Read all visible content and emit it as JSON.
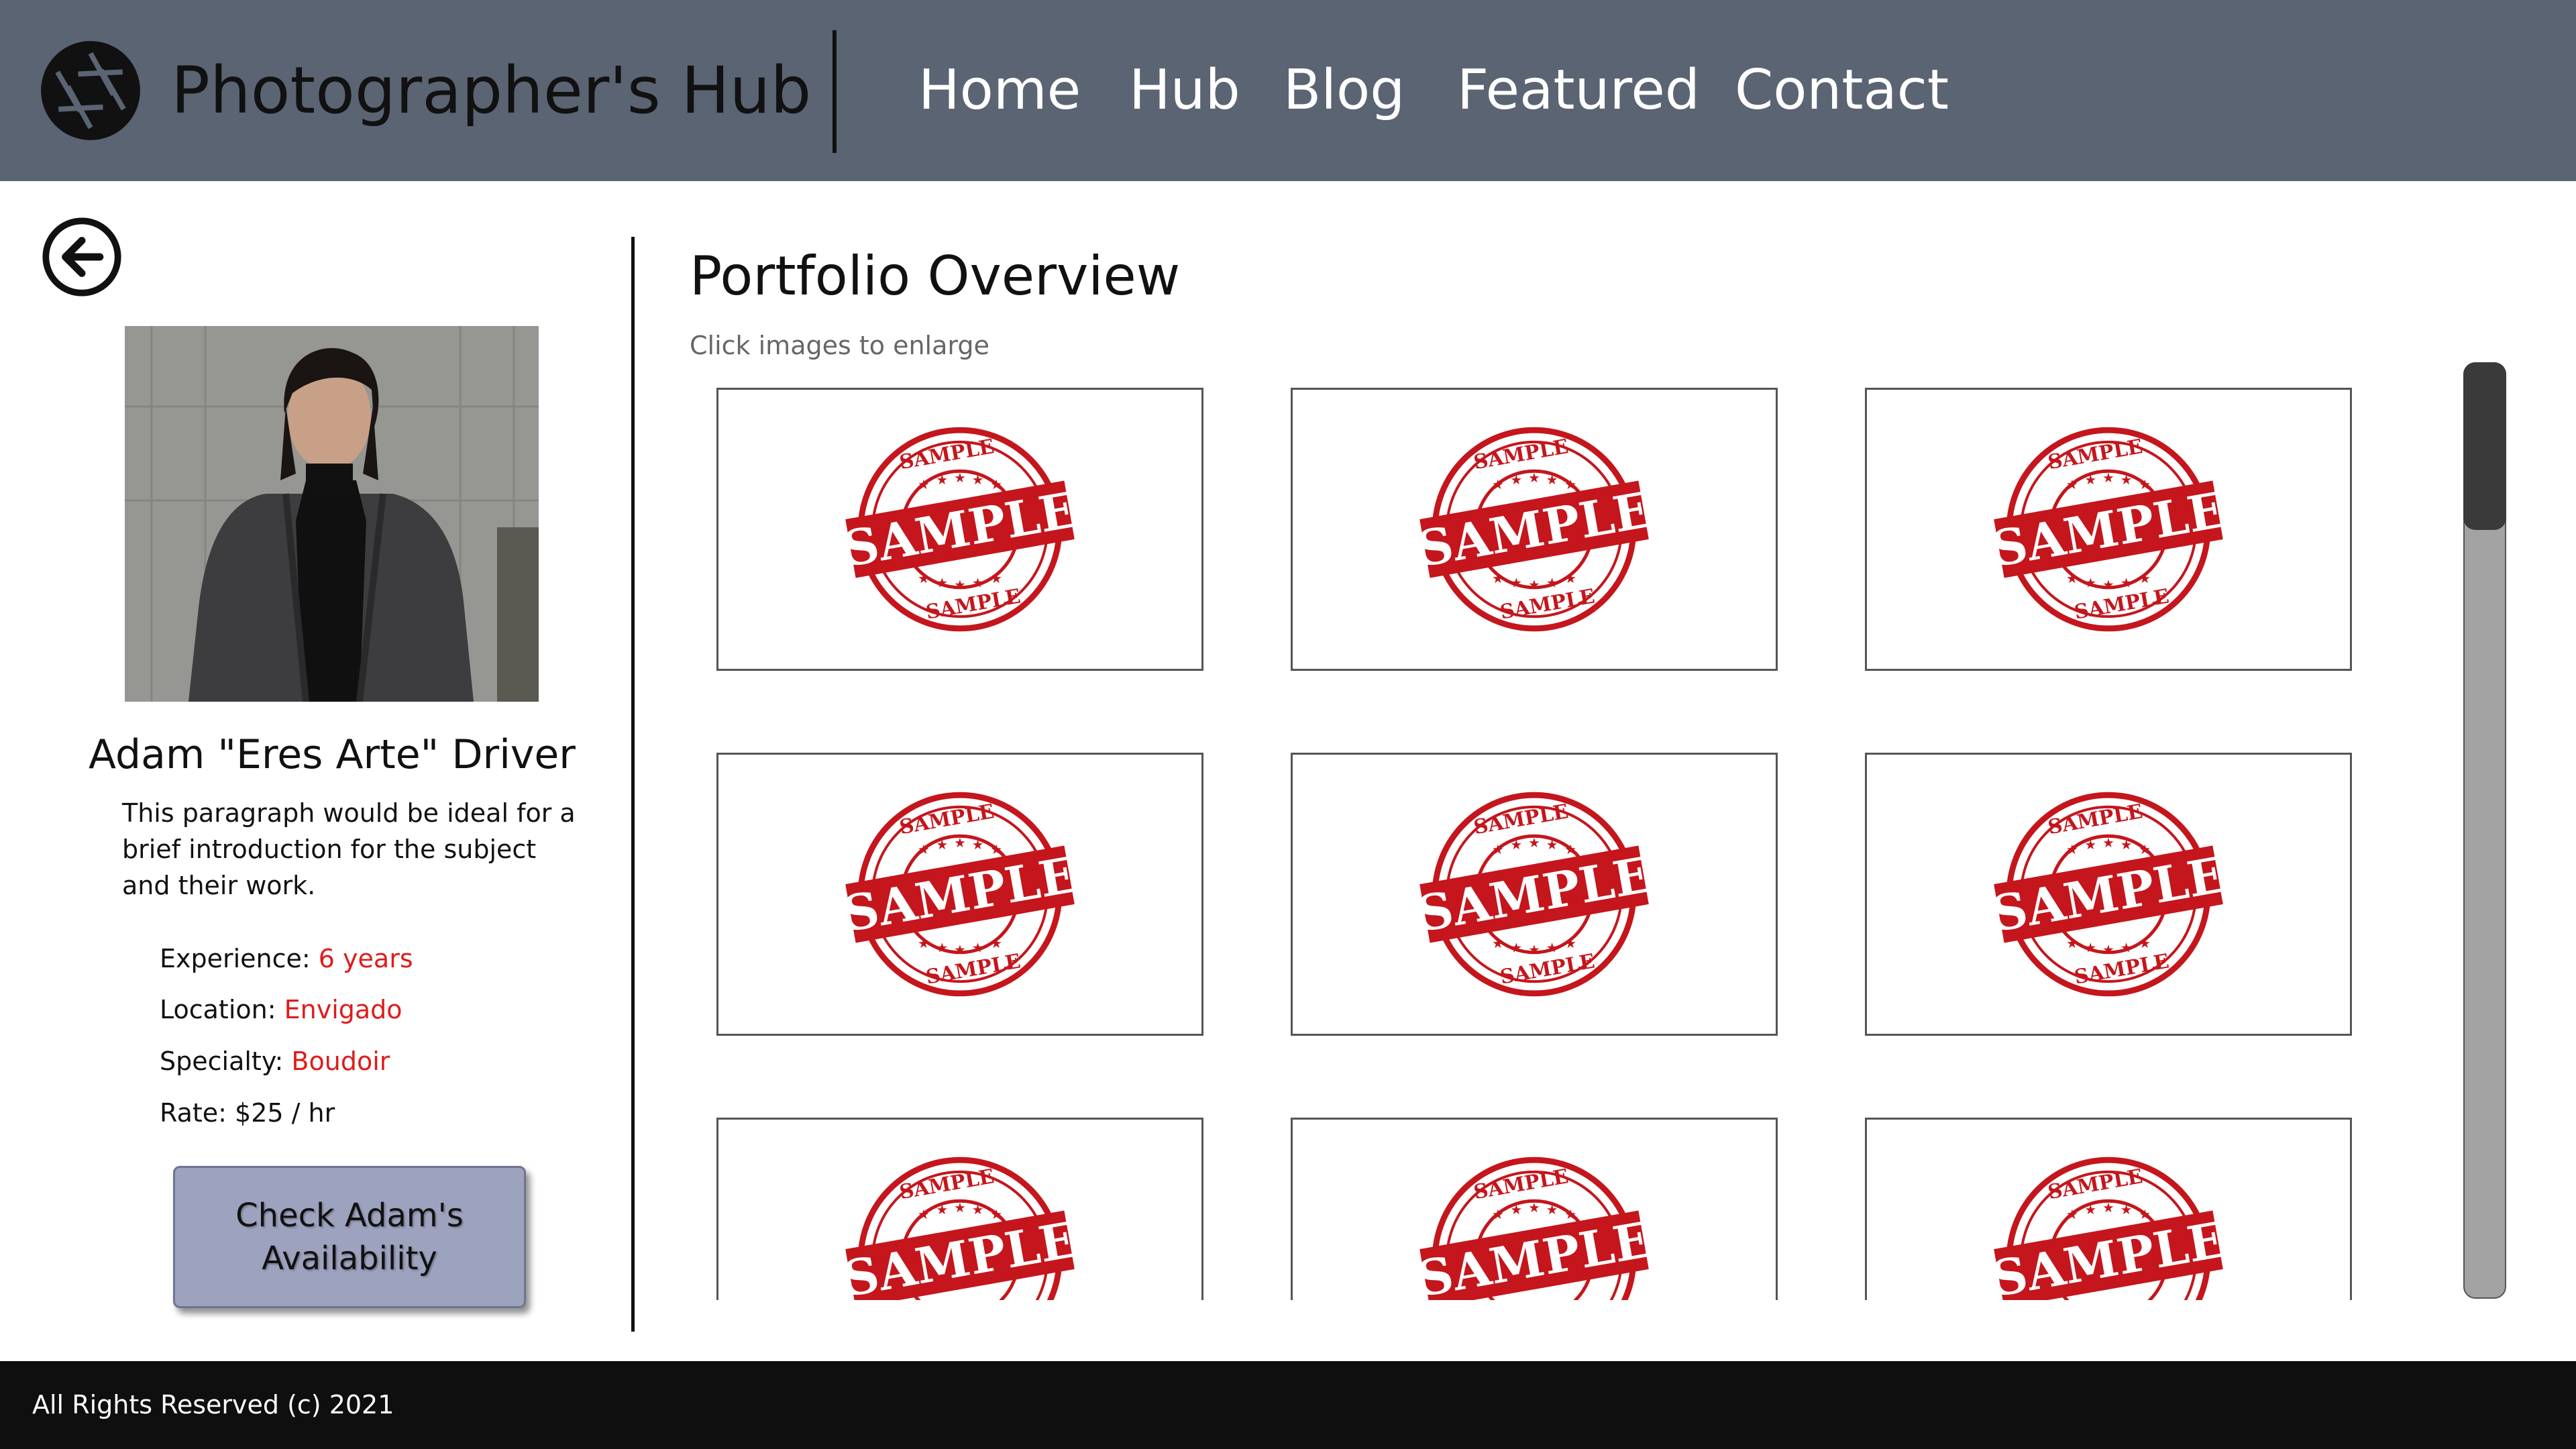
{
  "header": {
    "logo_icon": "camera-aperture-icon",
    "brand": "Photographer's Hub",
    "nav": [
      "Home",
      "Hub",
      "Blog",
      "Featured",
      "Contact"
    ]
  },
  "sidebar": {
    "back_icon": "arrow-left-circle-icon",
    "name": "Adam \"Eres Arte\" Driver",
    "intro": "This paragraph would be ideal for a brief introduction for the subject and their work.",
    "details": [
      {
        "label": "Experience: ",
        "value": "6 years"
      },
      {
        "label": "Location: ",
        "value": "Envigado"
      },
      {
        "label": "Specialty: ",
        "value": "Boudoir"
      },
      {
        "label": "Rate: $25 / hr",
        "value": ""
      }
    ],
    "cta_line1": "Check Adam's",
    "cta_line2": "Availability"
  },
  "main": {
    "title": "Portfolio Overview",
    "subtitle": "Click images to enlarge",
    "thumbnails": [
      {
        "stamp": "SAMPLE"
      },
      {
        "stamp": "SAMPLE"
      },
      {
        "stamp": "SAMPLE"
      },
      {
        "stamp": "SAMPLE"
      },
      {
        "stamp": "SAMPLE"
      },
      {
        "stamp": "SAMPLE"
      },
      {
        "stamp": "SAMPLE"
      },
      {
        "stamp": "SAMPLE"
      },
      {
        "stamp": "SAMPLE"
      }
    ]
  },
  "footer": {
    "text": "All Rights Reserved (c) 2021"
  },
  "colors": {
    "header_bg": "#5b6473",
    "accent_red": "#e01b1b",
    "stamp_red": "#c4161c",
    "cta_bg": "#9da2bf",
    "footer_bg": "#0f0f0f"
  }
}
